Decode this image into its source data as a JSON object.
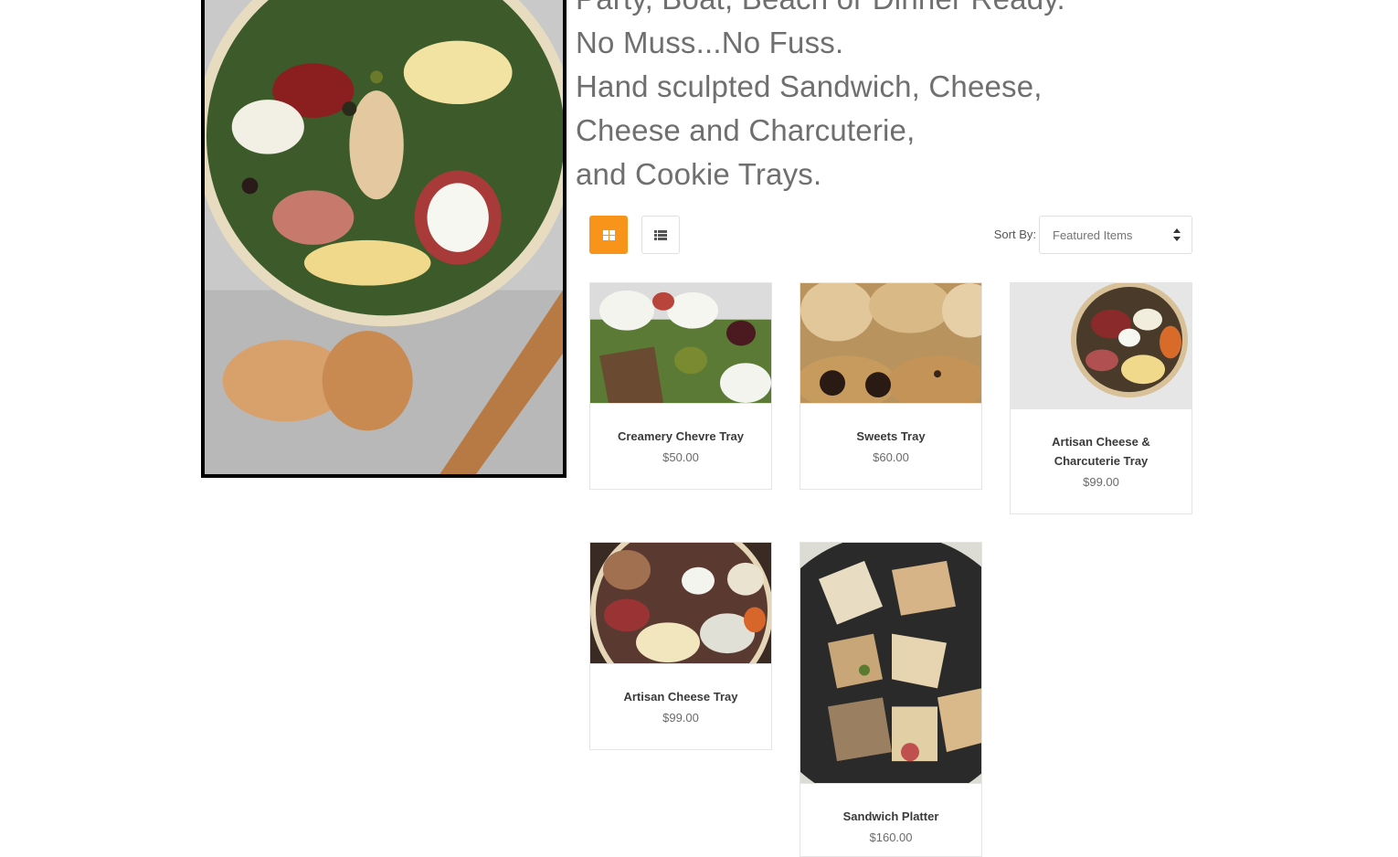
{
  "headline": {
    "line1": "Party, Boat, Beach or Dinner Ready.",
    "line2": "No Muss...No Fuss.",
    "line3": "Hand sculpted Sandwich, Cheese,",
    "line4": "Cheese and Charcuterie,",
    "line5": "and  Cookie Trays."
  },
  "toolbar": {
    "grid_icon": "grid-icon",
    "list_icon": "list-icon",
    "active_view": "grid",
    "accent_color": "#f79419",
    "sort_label": "Sort By:",
    "sort_value": "Featured Items"
  },
  "products": [
    {
      "title": "Creamery Chevre Tray",
      "price": "$50.00"
    },
    {
      "title": "Sweets Tray",
      "price": "$60.00"
    },
    {
      "title": "Artisan Cheese & Charcuterie Tray",
      "price": "$99.00"
    },
    {
      "title": "Artisan Cheese Tray",
      "price": "$99.00"
    },
    {
      "title": "Sandwich Platter",
      "price": "$160.00"
    }
  ]
}
